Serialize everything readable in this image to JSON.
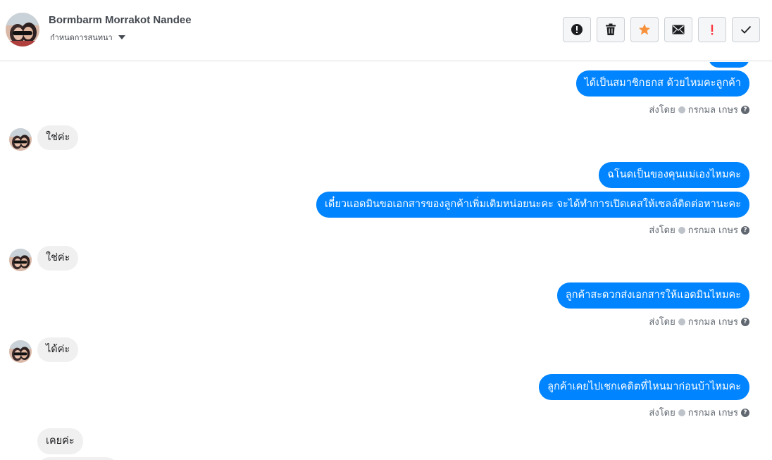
{
  "header": {
    "contact_name": "Bormbarm Morrakot Nandee",
    "subtitle": "กำหนดการสนทนา"
  },
  "toolbar": {
    "buttons": [
      {
        "name": "report-button",
        "icon": "exclamation-circle-icon"
      },
      {
        "name": "delete-button",
        "icon": "trash-icon"
      },
      {
        "name": "star-button",
        "icon": "star-icon",
        "color": "#f7923b"
      },
      {
        "name": "email-button",
        "icon": "envelope-icon"
      },
      {
        "name": "important-button",
        "icon": "exclamation-icon",
        "color": "#fa383e"
      },
      {
        "name": "done-button",
        "icon": "check-icon"
      }
    ]
  },
  "colors": {
    "outgoing_bubble": "#0084ff",
    "incoming_bubble": "#f1f0f0"
  },
  "messages": {
    "m1": "ได้เป็นสมาชิกธกส ด้วยไหมคะลูกค้า",
    "m2": "ใช่ค่ะ",
    "m3": "ฉโนดเป็นของคุนแม่เองไหมคะ",
    "m4": "เดี๋ยวแอดมินขอเอกสารของลูกค้าเพิ่มเติมหน่อยนะคะ จะได้ทำการเปิดเคสให้เซลล์ติดต่อหานะคะ",
    "m5": "ใช่ค่ะ",
    "m6": "ลูกค้าสะดวกส่งเอกสารให้แอดมินไหมคะ",
    "m7": "ได้ค่ะ",
    "m8": "ลูกค้าเคยไปเชกเคดิตที่ไหนมาก่อนบ้าไหมคะ",
    "m9": "เคยค่ะ"
  },
  "sent_by": {
    "label": "ส่งโดย",
    "agent": "กรกมล เกษร"
  }
}
